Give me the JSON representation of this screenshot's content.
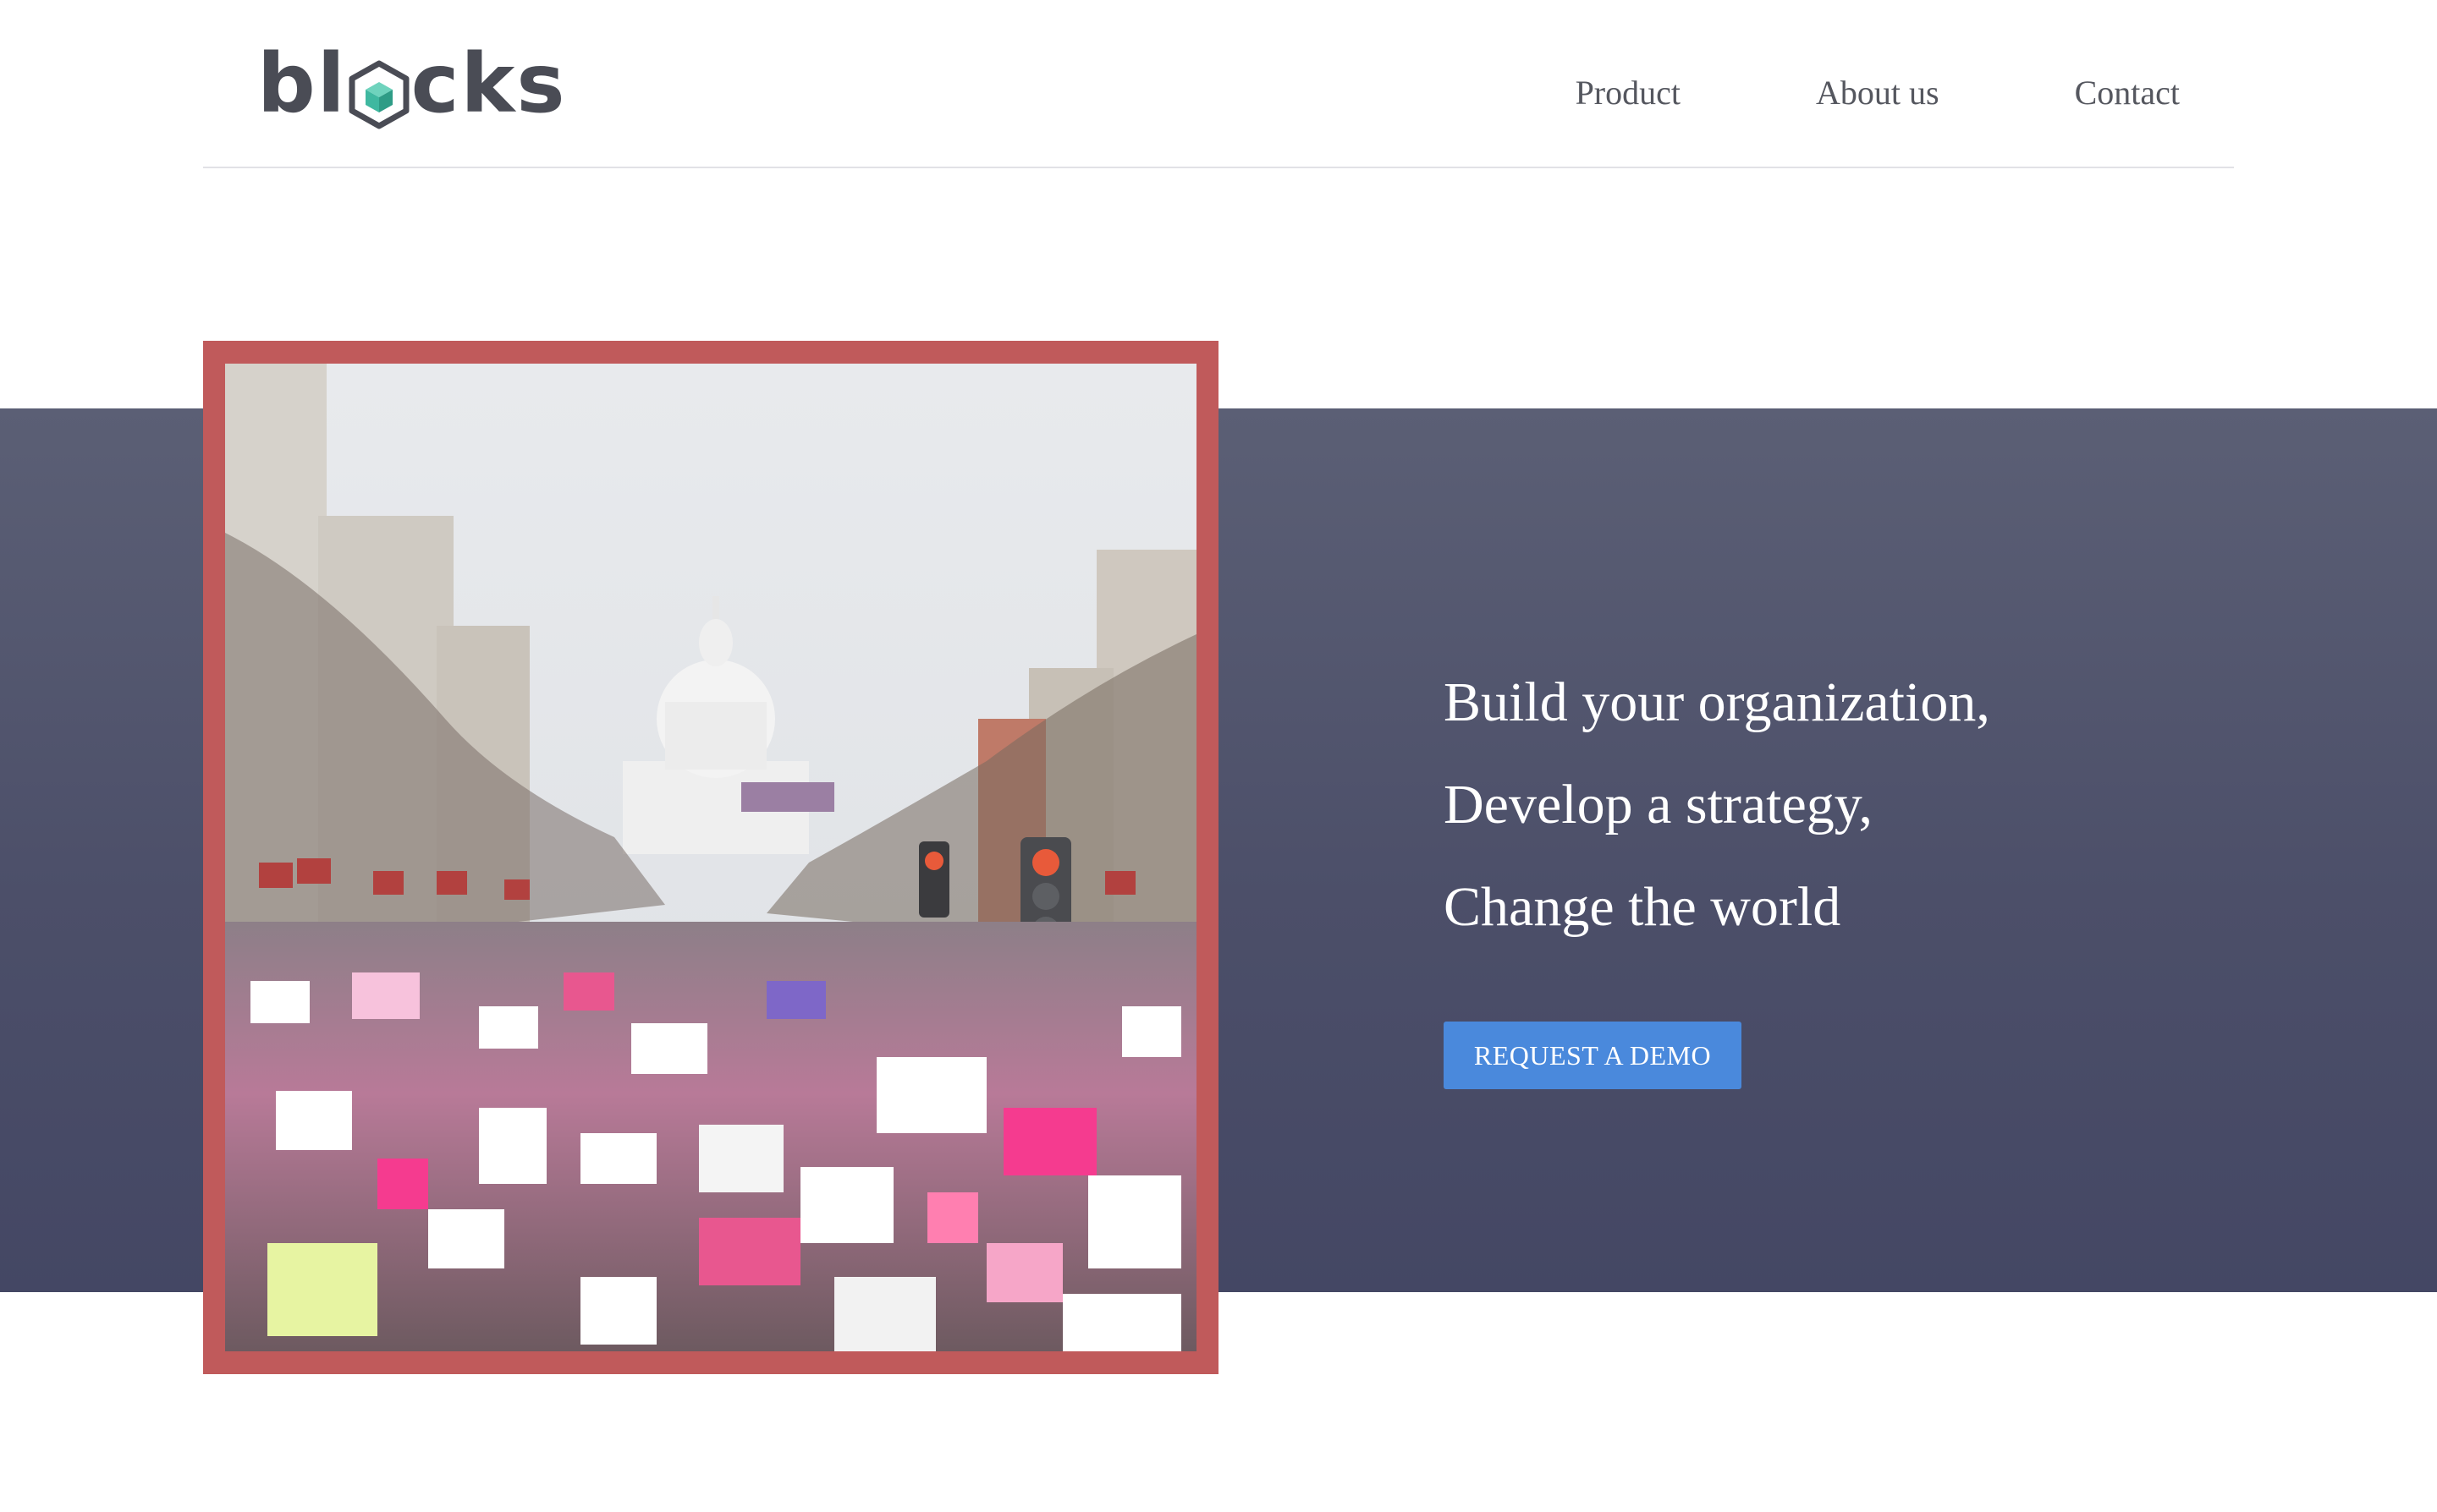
{
  "header": {
    "logo_text_before": "bl",
    "logo_text_after": "cks",
    "nav": {
      "product": "Product",
      "about": "About us",
      "contact": "Contact"
    }
  },
  "hero": {
    "lines": [
      "Build your organization,",
      "Develop a strategy,",
      "Change the world"
    ],
    "cta_label": "REQUEST A DEMO",
    "image_alt": "Crowd of protesters with signs marching toward the U.S. Capitol"
  },
  "colors": {
    "band": "#50536b",
    "frame": "#c05a5b",
    "cta": "#4a89dc",
    "logo_cube": "#3fb8a0"
  }
}
